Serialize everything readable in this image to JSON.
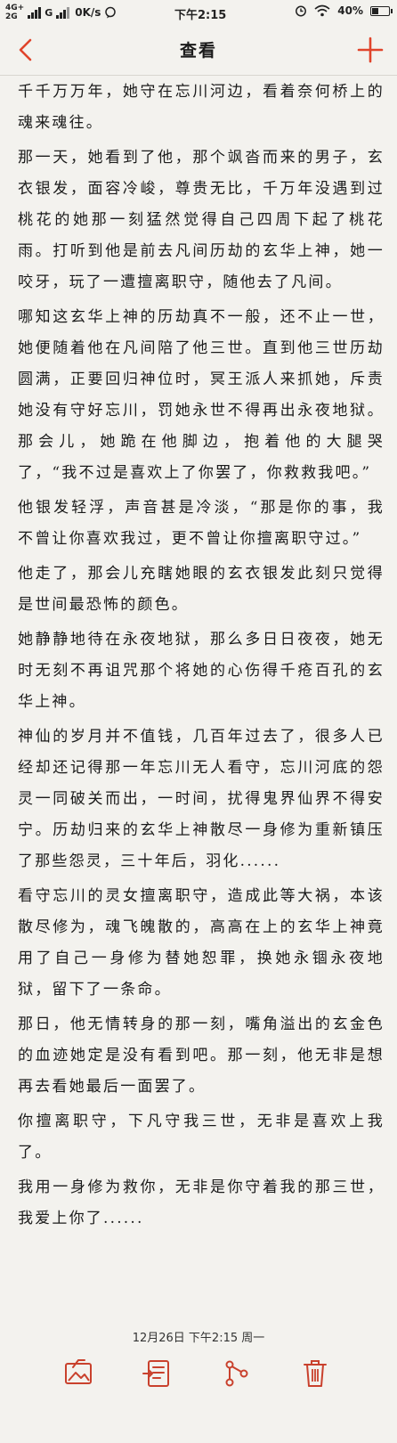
{
  "status_bar": {
    "network_top": "4G+",
    "network_bottom": "2G",
    "network_g": "G",
    "speed": "0K/s",
    "time": "下午2:15",
    "battery": "40%",
    "battery_level": 0.4
  },
  "nav": {
    "back_icon": "chevron-left-icon",
    "title": "查看",
    "add_icon": "plus-icon",
    "accent_color": "#e0442b"
  },
  "paragraphs": [
    "千千万万年，她守在忘川河边，看着奈何桥上的魂来魂往。",
    "那一天，她看到了他，那个飒沓而来的男子，玄衣银发，面容冷峻，尊贵无比，千万年没遇到过桃花的她那一刻猛然觉得自己四周下起了桃花雨。打听到他是前去凡间历劫的玄华上神，她一咬牙，玩了一遭擅离职守，随他去了凡间。",
    "哪知这玄华上神的历劫真不一般，还不止一世，她便随着他在凡间陪了他三世。直到他三世历劫圆满，正要回归神位时，冥王派人来抓她，斥责她没有守好忘川，罚她永世不得再出永夜地狱。那会儿，她跪在他脚边，抱着他的大腿哭了，“我不过是喜欢上了你罢了，你救救我吧。”",
    "他银发轻浮，声音甚是冷淡，“那是你的事，我不曾让你喜欢我过，更不曾让你擅离职守过。”",
    "他走了，那会儿充瞎她眼的玄衣银发此刻只觉得是世间最恐怖的颜色。",
    "她静静地待在永夜地狱，那么多日日夜夜，她无时无刻不再诅咒那个将她的心伤得千疮百孔的玄华上神。",
    "神仙的岁月并不值钱，几百年过去了，很多人已经却还记得那一年忘川无人看守，忘川河底的怨灵一同破关而出，一时间，扰得鬼界仙界不得安宁。历劫归来的玄华上神散尽一身修为重新镇压了那些怨灵，三十年后，羽化......",
    "看守忘川的灵女擅离职守，造成此等大祸，本该散尽修为，魂飞魄散的，高高在上的玄华上神竟用了自己一身修为替她恕罪，换她永锢永夜地狱，留下了一条命。",
    "那日，他无情转身的那一刻，嘴角溢出的玄金色的血迹她定是没有看到吧。那一刻，他无非是想再去看她最后一面罢了。",
    "你擅离职守，下凡守我三世，无非是喜欢上我了。",
    "我用一身修为救你，无非是你守着我的那三世，我爱上你了......"
  ],
  "footer": {
    "timestamp": "12月26日 下午2:15 周一"
  },
  "toolbar": {
    "accent_color": "#c9412d",
    "items": [
      {
        "icon": "image-share-icon"
      },
      {
        "icon": "export-note-icon"
      },
      {
        "icon": "share-icon"
      },
      {
        "icon": "trash-icon"
      }
    ]
  }
}
